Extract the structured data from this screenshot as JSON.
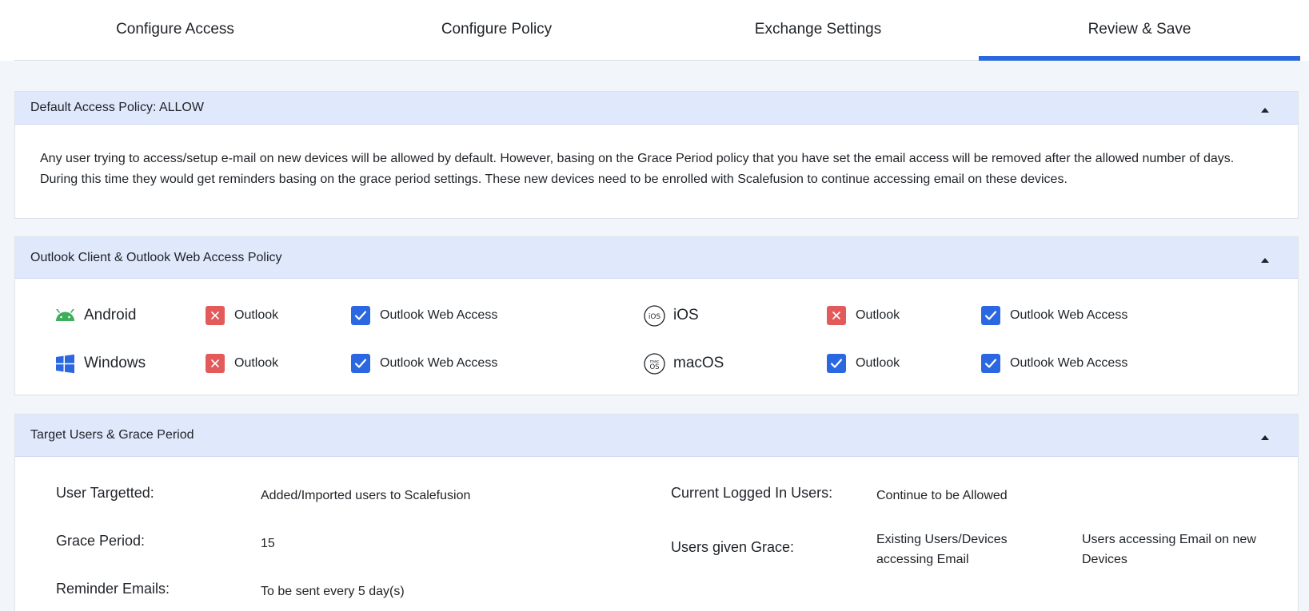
{
  "tabs": [
    {
      "label": "Configure Access"
    },
    {
      "label": "Configure Policy"
    },
    {
      "label": "Exchange Settings"
    },
    {
      "label": "Review & Save"
    }
  ],
  "active_tab": "Review & Save",
  "accent_color": "#2a67e0",
  "default_policy": {
    "title": "Default Access Policy: ALLOW",
    "text_line1": "Any user trying to access/setup e-mail on new devices will be allowed by default. However, basing on the Grace Period policy that you have set the email access will be removed after the allowed number of days.",
    "text_line2": "During this time they would get reminders basing on the grace period settings. These new devices need to be enrolled with Scalefusion to continue accessing email on these devices."
  },
  "outlook_policy": {
    "title": "Outlook Client & Outlook Web Access Policy",
    "platforms": [
      {
        "name": "Android",
        "icon": "android-icon",
        "outlook_label": "Outlook",
        "outlook_allowed": false,
        "owa_label": "Outlook Web Access",
        "owa_allowed": true
      },
      {
        "name": "iOS",
        "icon": "ios-icon",
        "outlook_label": "Outlook",
        "outlook_allowed": false,
        "owa_label": "Outlook Web Access",
        "owa_allowed": true
      },
      {
        "name": "Windows",
        "icon": "windows-icon",
        "outlook_label": "Outlook",
        "outlook_allowed": false,
        "owa_label": "Outlook Web Access",
        "owa_allowed": true
      },
      {
        "name": "macOS",
        "icon": "macos-icon",
        "outlook_label": "Outlook",
        "outlook_allowed": true,
        "owa_label": "Outlook Web Access",
        "owa_allowed": true
      }
    ],
    "ios_badge": "iOS",
    "macos_badge_top": "mac",
    "macos_badge_bottom": "OS"
  },
  "target_users": {
    "title": "Target Users & Grace Period",
    "user_targetted_label": "User Targetted:",
    "user_targetted_value": "Added/Imported users to Scalefusion",
    "grace_period_label": "Grace Period:",
    "grace_period_value": "15",
    "reminder_label": "Reminder Emails:",
    "reminder_value": "To be sent every 5 day(s)",
    "current_logged_label": "Current Logged In Users:",
    "current_logged_value": "Continue to be Allowed",
    "users_grace_label": "Users given Grace:",
    "users_grace_value1_line1": "Existing Users/Devices",
    "users_grace_value1_line2": "accessing Email",
    "users_grace_value2_line1": "Users accessing Email on new",
    "users_grace_value2_line2": "Devices"
  }
}
